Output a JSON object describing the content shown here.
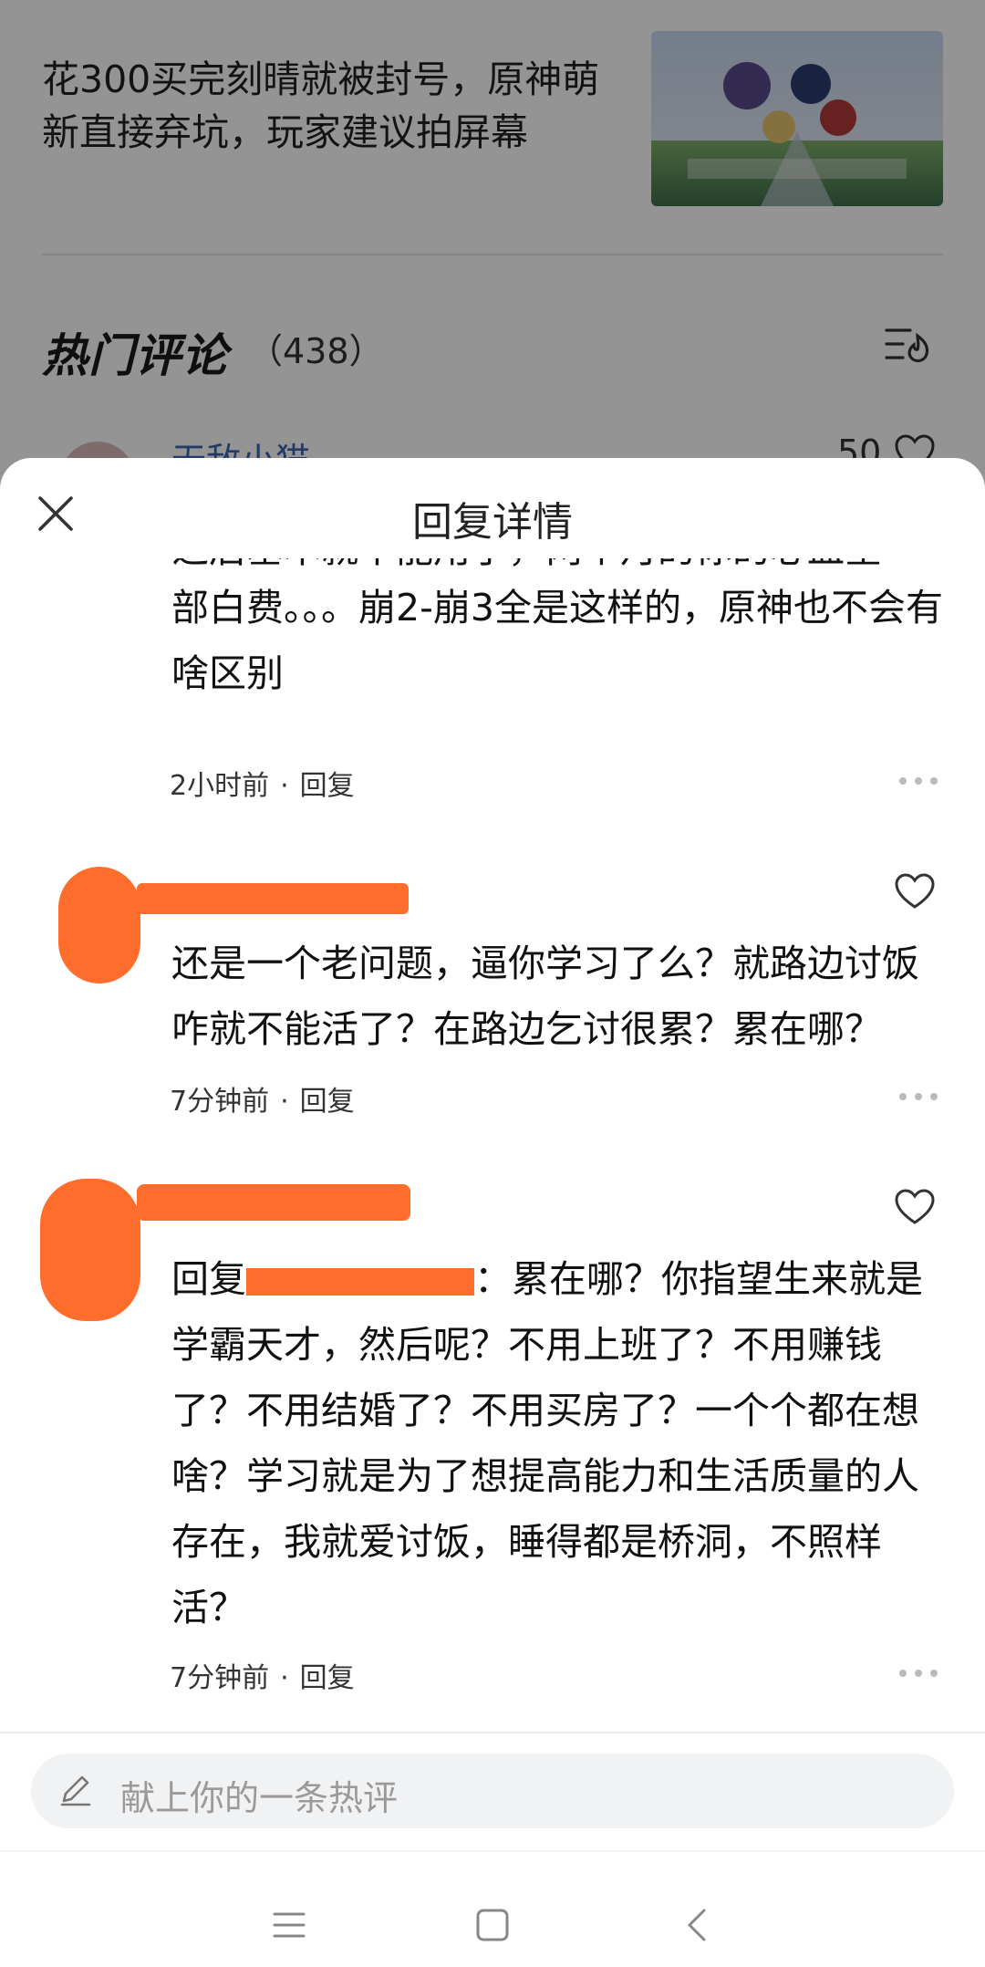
{
  "article": {
    "title": "花300买完刻晴就被封号，原神萌新直接弃坑，玩家建议拍屏幕",
    "thumbnail_icon": "game-art-thumbnail"
  },
  "hot_comments": {
    "title": "热门评论",
    "count": "（438）",
    "peek_user": "无敌小猫",
    "peek_likes": "50"
  },
  "sheet": {
    "title": "回复详情"
  },
  "comments": [
    {
      "text_top_partial": "之后基本就不能用了，两个月的你的心血全",
      "text": "部白费。。。崩2-崩3全是这样的，原神也不会有啥区别",
      "time": "2小时前",
      "reply_label": "回复"
    },
    {
      "text": "还是一个老问题，逼你学习了么？就路边讨饭咋就不能活了？在路边乞讨很累？累在哪？",
      "time": "7分钟前",
      "reply_label": "回复"
    },
    {
      "text_prefix": "回复",
      "text": "：累在哪？你指望生来就是学霸天才，然后呢？不用上班了？不用赚钱了？不用结婚了？不用买房了？一个个都在想啥？学习就是为了想提高能力和生活质量的人存在，我就爱讨饭，睡得都是桥洞，不照样活？",
      "time": "7分钟前",
      "reply_label": "回复"
    }
  ],
  "input": {
    "placeholder": "献上你的一条热评"
  },
  "colors": {
    "redaction": "#ff6d2d",
    "username_link": "#3b66b0"
  }
}
